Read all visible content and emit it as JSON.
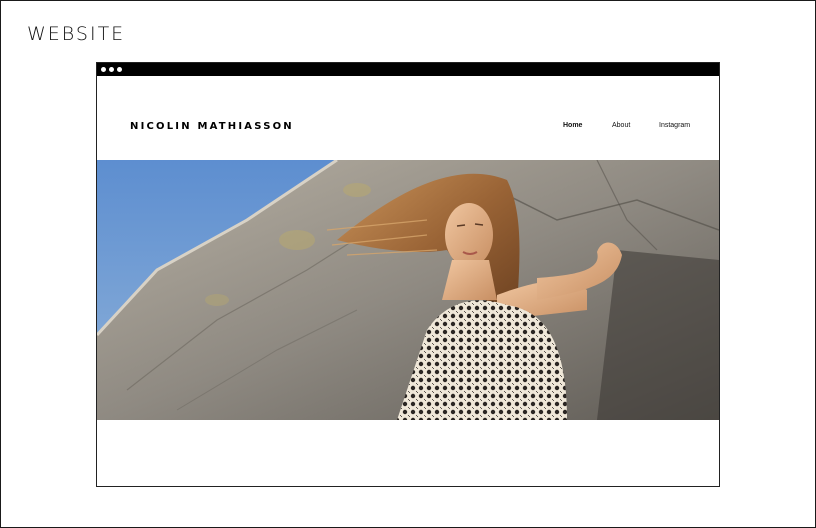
{
  "section_title": "WEBSITE",
  "browser": {
    "window_controls": [
      "dot",
      "dot",
      "dot"
    ]
  },
  "site": {
    "logo_text": "NICOLIN MATHIASSON",
    "nav": {
      "home": "Home",
      "about": "About",
      "instagram": "Instagram"
    },
    "hero_image": "photo-of-woman-with-windblown-hair-against-stone-wall"
  },
  "colors": {
    "chrome_bar": "#000000",
    "sky": "#6f9bcf",
    "stone": "#9a958c"
  }
}
